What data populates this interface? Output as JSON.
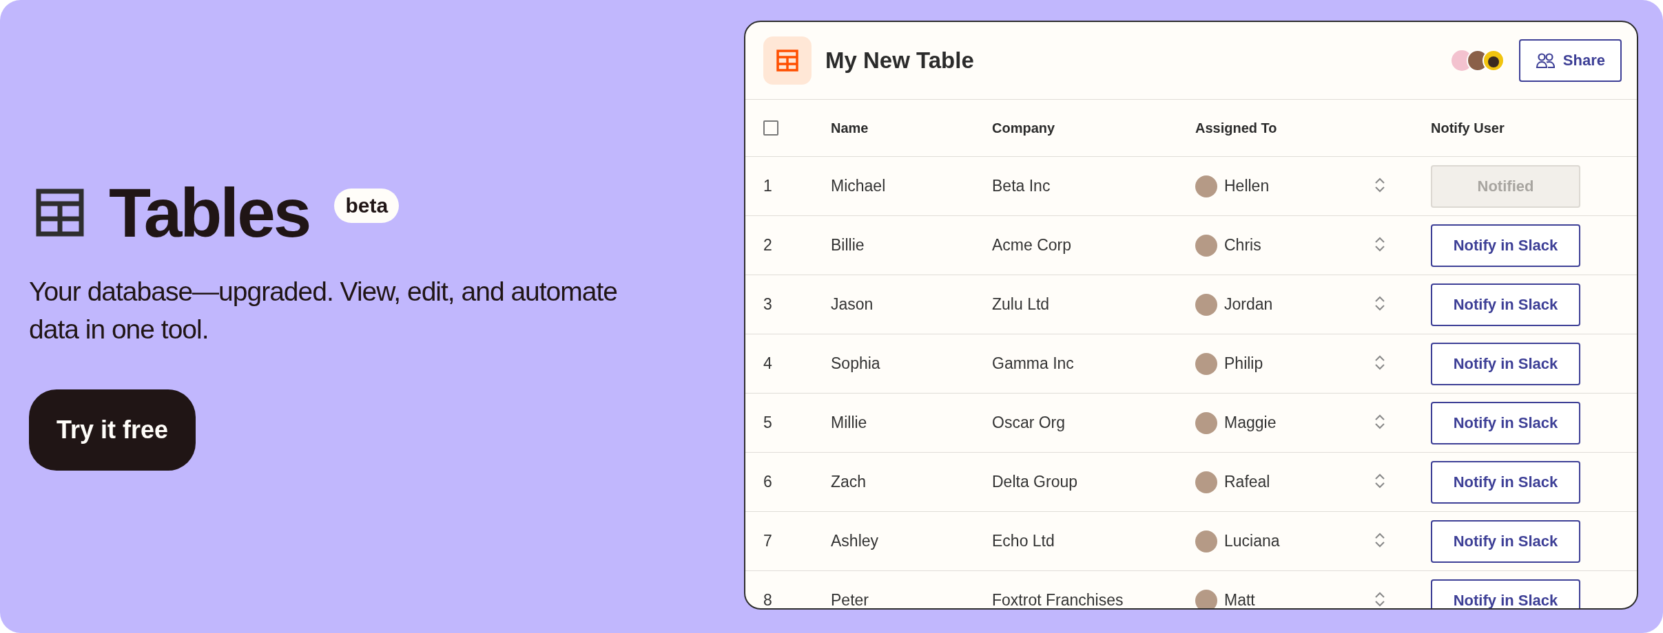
{
  "hero": {
    "title": "Tables",
    "badge": "beta",
    "subtitle": "Your database—upgraded. View, edit, and automate data in one tool.",
    "cta": "Try it free"
  },
  "table_window": {
    "title": "My New Table",
    "share_button": "Share",
    "columns": [
      "Name",
      "Company",
      "Assigned To",
      "Notify User"
    ],
    "select_all": {
      "checked": false
    },
    "rows": [
      {
        "number": "1",
        "name": "Michael",
        "company": "Beta Inc",
        "assignee": "Hellen",
        "action": "Notified",
        "disabled": true
      },
      {
        "number": "2",
        "name": "Billie",
        "company": "Acme Corp",
        "assignee": "Chris",
        "action": "Notify in Slack",
        "disabled": false
      },
      {
        "number": "3",
        "name": "Jason",
        "company": "Zulu Ltd",
        "assignee": "Jordan",
        "action": "Notify in Slack",
        "disabled": false
      },
      {
        "number": "4",
        "name": "Sophia",
        "company": "Gamma Inc",
        "assignee": "Philip",
        "action": "Notify in Slack",
        "disabled": false
      },
      {
        "number": "5",
        "name": "Millie",
        "company": "Oscar Org",
        "assignee": "Maggie",
        "action": "Notify in Slack",
        "disabled": false
      },
      {
        "number": "6",
        "name": "Zach",
        "company": "Delta Group",
        "assignee": "Rafeal",
        "action": "Notify in Slack",
        "disabled": false
      },
      {
        "number": "7",
        "name": "Ashley",
        "company": "Echo Ltd",
        "assignee": "Luciana",
        "action": "Notify in Slack",
        "disabled": false
      },
      {
        "number": "8",
        "name": "Peter",
        "company": "Foxtrot Franchises",
        "assignee": "Matt",
        "action": "Notify in Slack",
        "disabled": false
      }
    ]
  }
}
